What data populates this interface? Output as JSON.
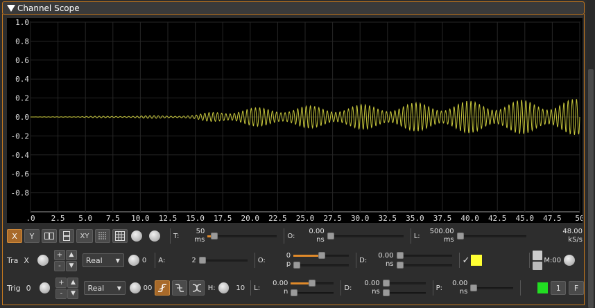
{
  "window": {
    "title": "Channel Scope"
  },
  "chart_data": {
    "type": "line",
    "title": "",
    "xlabel": "",
    "ylabel": "",
    "xlim": [
      0,
      50
    ],
    "ylim": [
      -1.0,
      1.0
    ],
    "x_ticks": [
      ".0",
      "2.5",
      "5.0",
      "7.5",
      "10.0",
      "12.5",
      "15.0",
      "17.5",
      "20.0",
      "22.5",
      "25.0",
      "27.5",
      "30.0",
      "32.5",
      "35.0",
      "37.5",
      "40.0",
      "42.5",
      "45.0",
      "47.5",
      "50"
    ],
    "y_ticks": [
      "1.0",
      "0.8",
      "0.6",
      "0.4",
      "0.2",
      "0.0",
      "-0.2",
      "-0.4",
      "-0.6",
      "-0.8"
    ],
    "grid": true,
    "series_color": "#c8c83c",
    "envelope": [
      {
        "t": 0,
        "amp": 0.0
      },
      {
        "t": 4,
        "amp": 0.005
      },
      {
        "t": 15,
        "amp": 0.02
      },
      {
        "t": 17.5,
        "amp": 0.08
      },
      {
        "t": 22.5,
        "amp": 0.11
      },
      {
        "t": 30,
        "amp": 0.13
      },
      {
        "t": 40,
        "amp": 0.17
      },
      {
        "t": 50,
        "amp": 0.19
      }
    ]
  },
  "controls1": {
    "x_label": "X",
    "y_label": "Y",
    "xy_label": "XY",
    "t_label": "T:",
    "t_value": "50",
    "t_unit": "ms",
    "t_level": 0.05,
    "o_label": "O:",
    "o_value": "0.00",
    "o_unit": "ns",
    "l_label": "L:",
    "l_value": "500.00",
    "l_unit": "ms",
    "rate_value": "48.00",
    "rate_unit": "kS/s"
  },
  "controls2": {
    "tra_label": "Tra",
    "trace_name": "X",
    "plus": "+",
    "minus": "-",
    "mode_value": "Real",
    "knob_value": "0",
    "a_label": "A:",
    "a_value": "2",
    "o_label": "O:",
    "o_value": "0",
    "o_unit": "p",
    "d_label": "D:",
    "d_value": "0.00",
    "d_unit": "ns",
    "check": "✓",
    "trace_color": "#ffff33",
    "m_label": "M:00"
  },
  "controls3": {
    "trig_label": "Trig",
    "trig_index": "0",
    "plus": "+",
    "minus": "-",
    "mode_value": "Real",
    "level_value": "00",
    "h_label": "H:",
    "h_value": "10",
    "l_label": "L:",
    "l_value": "0.00",
    "l_unit": "n",
    "d_label": "D:",
    "d_value": "0.00",
    "d_unit": "ns",
    "p_label": "P:",
    "p_value": "0.00",
    "p_unit": "ns",
    "status_color": "#22dd22",
    "count_label": "1",
    "f_label": "F"
  }
}
